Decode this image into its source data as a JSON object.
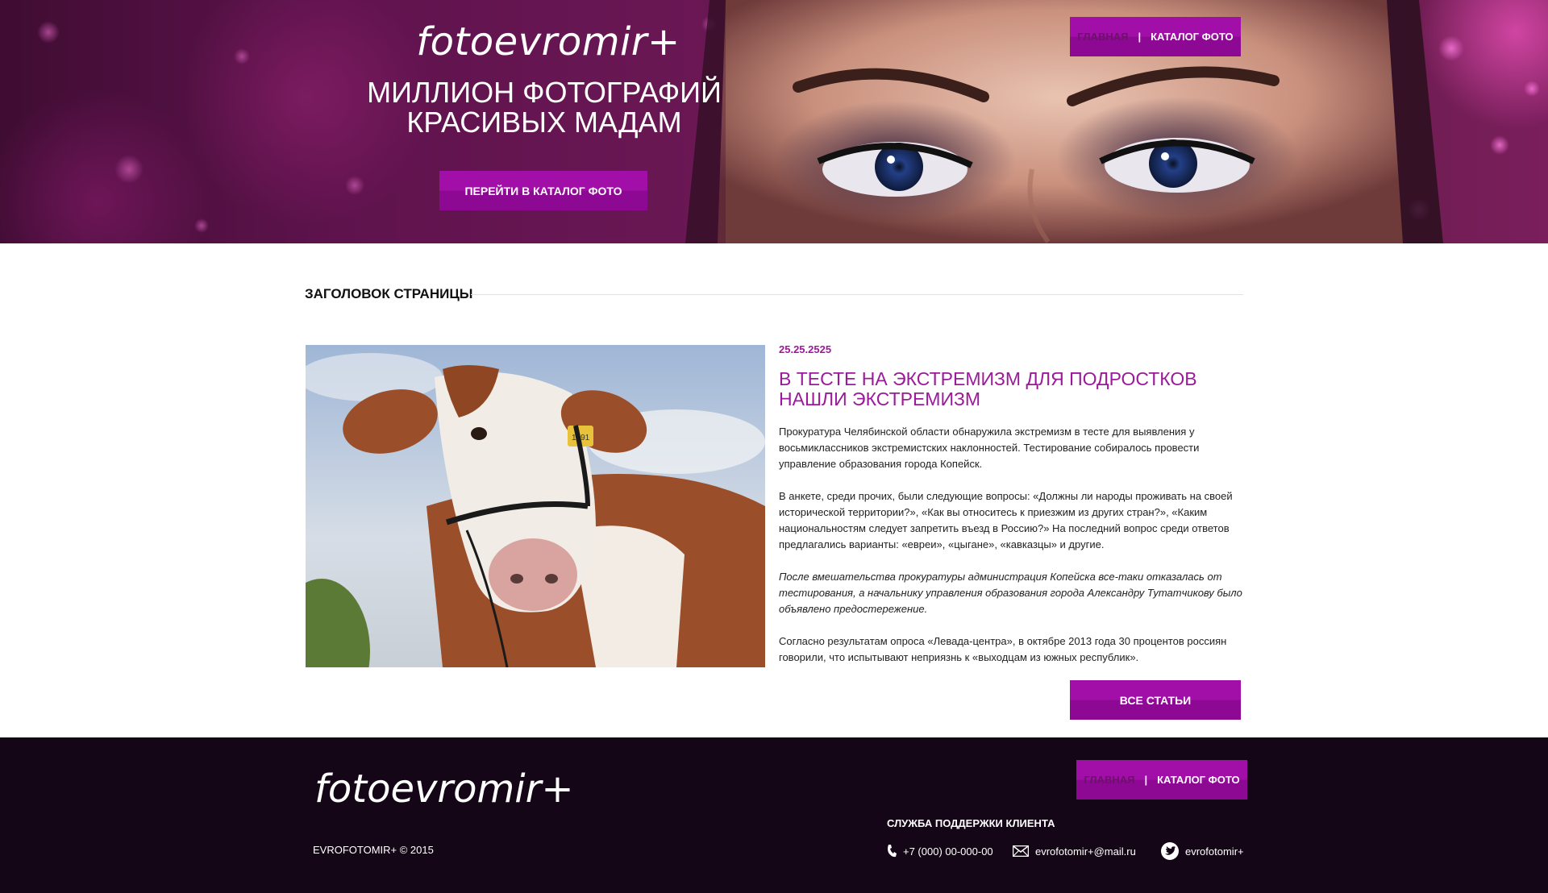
{
  "brand": {
    "logo": "fotoevromir+"
  },
  "nav": {
    "home": "ГЛАВНАЯ",
    "separator": "|",
    "catalog": "КАТАЛОГ ФОТО"
  },
  "hero": {
    "title_line1": "МИЛЛИОН ФОТОГРАФИЙ",
    "title_line2": "КРАСИВЫХ МАДАМ",
    "button": "ПЕРЕЙТИ В КАТАЛОГ ФОТО"
  },
  "page": {
    "heading": "ЗАГОЛОВОК СТРАНИЦЫ"
  },
  "article": {
    "date": "25.25.2525",
    "title_line1": "В ТЕСТЕ НА ЭКСТРЕМИЗМ ДЛЯ ПОДРОСТКОВ",
    "title_line2": "НАШЛИ ЭКСТРЕМИЗМ",
    "paragraphs": [
      "Прокуратура Челябинской области обнаружила экстремизм в тесте для выявления у восьмиклассников экстремистских наклонностей. Тестирование собиралось провести управление образования города Копейск.",
      "В анкете, среди прочих, были следующие вопросы: «Должны ли народы проживать на своей исторической территории?», «Как вы относитесь к приезжим из других стран?», «Каким национальностям следует запретить въезд в Россию?» На последний вопрос среди ответов предлагались варианты: «евреи», «цыгане», «кавказцы» и другие.",
      "После вмешательства прокуратуры администрация Копейска все-таки отказалась от тестирования, а начальнику управления образования города Александру Тутатчикову было объявлено предостережение.",
      "Согласно результатам опроса «Левада-центра», в октябре 2013 года 30 процентов россиян говорили, что испытывают неприязнь к «выходцам из южных республик»."
    ],
    "tag_number": "1691",
    "all_button": "ВСЕ СТАТЬИ"
  },
  "footer": {
    "copyright": "EVROFOTOMIR+ © 2015",
    "support_title": "СЛУЖБА ПОДДЕРЖКИ КЛИЕНТА",
    "phone": "+7 (000) 00-000-00",
    "email": "evrofotomir+@mail.ru",
    "twitter": "evrofotomir+"
  },
  "colors": {
    "accent": "#9b1a9a",
    "button": "#a20fa8",
    "footer_bg": "#140616",
    "nav_active": "#6b1368"
  },
  "icons": [
    "phone-icon",
    "mail-icon",
    "twitter-icon"
  ]
}
